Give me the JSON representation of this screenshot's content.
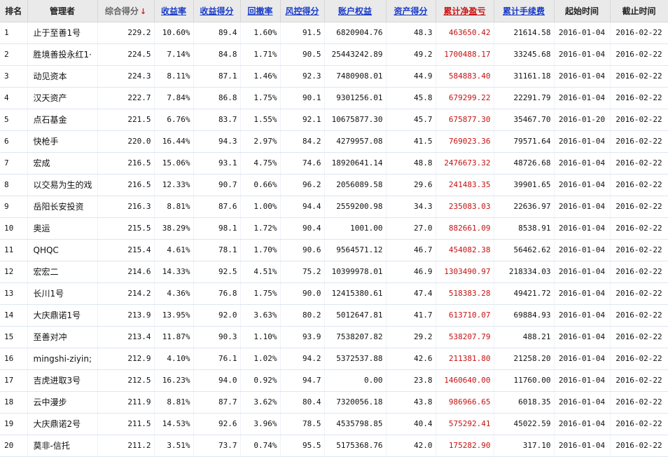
{
  "columns": [
    {
      "key": "rank",
      "label": "排名"
    },
    {
      "key": "manager",
      "label": "管理者"
    },
    {
      "key": "total_score",
      "label": "综合得分",
      "sort_icon": "down-arrow-icon"
    },
    {
      "key": "return_rate",
      "label": "收益率"
    },
    {
      "key": "return_score",
      "label": "收益得分"
    },
    {
      "key": "drawdown",
      "label": "回撤率"
    },
    {
      "key": "risk_score",
      "label": "风控得分"
    },
    {
      "key": "equity",
      "label": "账户权益"
    },
    {
      "key": "asset_score",
      "label": "资产得分"
    },
    {
      "key": "net_pnl",
      "label": "累计净盈亏"
    },
    {
      "key": "fees",
      "label": "累计手续费"
    },
    {
      "key": "start",
      "label": "起始时间"
    },
    {
      "key": "end",
      "label": "截止时间"
    }
  ],
  "rows": [
    {
      "rank": "1",
      "manager": "止于至善1号",
      "total_score": "229.2",
      "return_rate": "10.60%",
      "return_score": "89.4",
      "drawdown": "1.60%",
      "risk_score": "91.5",
      "equity": "6820904.76",
      "asset_score": "48.3",
      "net_pnl": "463650.42",
      "fees": "21614.58",
      "start": "2016-01-04",
      "end": "2016-02-22"
    },
    {
      "rank": "2",
      "manager": "胜境善投永红1·",
      "total_score": "224.5",
      "return_rate": "7.14%",
      "return_score": "84.8",
      "drawdown": "1.71%",
      "risk_score": "90.5",
      "equity": "25443242.89",
      "asset_score": "49.2",
      "net_pnl": "1700488.17",
      "fees": "33245.68",
      "start": "2016-01-04",
      "end": "2016-02-22"
    },
    {
      "rank": "3",
      "manager": "动见资本",
      "total_score": "224.3",
      "return_rate": "8.11%",
      "return_score": "87.1",
      "drawdown": "1.46%",
      "risk_score": "92.3",
      "equity": "7480908.01",
      "asset_score": "44.9",
      "net_pnl": "584883.40",
      "fees": "31161.18",
      "start": "2016-01-04",
      "end": "2016-02-22"
    },
    {
      "rank": "4",
      "manager": "汉天资产",
      "total_score": "222.7",
      "return_rate": "7.84%",
      "return_score": "86.8",
      "drawdown": "1.75%",
      "risk_score": "90.1",
      "equity": "9301256.01",
      "asset_score": "45.8",
      "net_pnl": "679299.22",
      "fees": "22291.79",
      "start": "2016-01-04",
      "end": "2016-02-22"
    },
    {
      "rank": "5",
      "manager": "点石基金",
      "total_score": "221.5",
      "return_rate": "6.76%",
      "return_score": "83.7",
      "drawdown": "1.55%",
      "risk_score": "92.1",
      "equity": "10675877.30",
      "asset_score": "45.7",
      "net_pnl": "675877.30",
      "fees": "35467.70",
      "start": "2016-01-20",
      "end": "2016-02-22"
    },
    {
      "rank": "6",
      "manager": "快枪手",
      "total_score": "220.0",
      "return_rate": "16.44%",
      "return_score": "94.3",
      "drawdown": "2.97%",
      "risk_score": "84.2",
      "equity": "4279957.08",
      "asset_score": "41.5",
      "net_pnl": "769023.36",
      "fees": "79571.64",
      "start": "2016-01-04",
      "end": "2016-02-22"
    },
    {
      "rank": "7",
      "manager": "宏成",
      "total_score": "216.5",
      "return_rate": "15.06%",
      "return_score": "93.1",
      "drawdown": "4.75%",
      "risk_score": "74.6",
      "equity": "18920641.14",
      "asset_score": "48.8",
      "net_pnl": "2476673.32",
      "fees": "48726.68",
      "start": "2016-01-04",
      "end": "2016-02-22"
    },
    {
      "rank": "8",
      "manager": "以交易为生的戏",
      "total_score": "216.5",
      "return_rate": "12.33%",
      "return_score": "90.7",
      "drawdown": "0.66%",
      "risk_score": "96.2",
      "equity": "2056089.58",
      "asset_score": "29.6",
      "net_pnl": "241483.35",
      "fees": "39901.65",
      "start": "2016-01-04",
      "end": "2016-02-22"
    },
    {
      "rank": "9",
      "manager": "岳阳长安投资",
      "total_score": "216.3",
      "return_rate": "8.81%",
      "return_score": "87.6",
      "drawdown": "1.00%",
      "risk_score": "94.4",
      "equity": "2559200.98",
      "asset_score": "34.3",
      "net_pnl": "235083.03",
      "fees": "22636.97",
      "start": "2016-01-04",
      "end": "2016-02-22"
    },
    {
      "rank": "10",
      "manager": "奥运",
      "total_score": "215.5",
      "return_rate": "38.29%",
      "return_score": "98.1",
      "drawdown": "1.72%",
      "risk_score": "90.4",
      "equity": "1001.00",
      "asset_score": "27.0",
      "net_pnl": "882661.09",
      "fees": "8538.91",
      "start": "2016-01-04",
      "end": "2016-02-22"
    },
    {
      "rank": "11",
      "manager": "QHQC",
      "total_score": "215.4",
      "return_rate": "4.61%",
      "return_score": "78.1",
      "drawdown": "1.70%",
      "risk_score": "90.6",
      "equity": "9564571.12",
      "asset_score": "46.7",
      "net_pnl": "454082.38",
      "fees": "56462.62",
      "start": "2016-01-04",
      "end": "2016-02-22"
    },
    {
      "rank": "12",
      "manager": "宏宏二",
      "total_score": "214.6",
      "return_rate": "14.33%",
      "return_score": "92.5",
      "drawdown": "4.51%",
      "risk_score": "75.2",
      "equity": "10399978.01",
      "asset_score": "46.9",
      "net_pnl": "1303490.97",
      "fees": "218334.03",
      "start": "2016-01-04",
      "end": "2016-02-22"
    },
    {
      "rank": "13",
      "manager": "长川1号",
      "total_score": "214.2",
      "return_rate": "4.36%",
      "return_score": "76.8",
      "drawdown": "1.75%",
      "risk_score": "90.0",
      "equity": "12415380.61",
      "asset_score": "47.4",
      "net_pnl": "518383.28",
      "fees": "49421.72",
      "start": "2016-01-04",
      "end": "2016-02-22"
    },
    {
      "rank": "14",
      "manager": "大庆鼎诺1号",
      "total_score": "213.9",
      "return_rate": "13.95%",
      "return_score": "92.0",
      "drawdown": "3.63%",
      "risk_score": "80.2",
      "equity": "5012647.81",
      "asset_score": "41.7",
      "net_pnl": "613710.07",
      "fees": "69884.93",
      "start": "2016-01-04",
      "end": "2016-02-22"
    },
    {
      "rank": "15",
      "manager": "至善对冲",
      "total_score": "213.4",
      "return_rate": "11.87%",
      "return_score": "90.3",
      "drawdown": "1.10%",
      "risk_score": "93.9",
      "equity": "7538207.82",
      "asset_score": "29.2",
      "net_pnl": "538207.79",
      "fees": "488.21",
      "start": "2016-01-04",
      "end": "2016-02-22"
    },
    {
      "rank": "16",
      "manager": "mingshi-ziyin;",
      "total_score": "212.9",
      "return_rate": "4.10%",
      "return_score": "76.1",
      "drawdown": "1.02%",
      "risk_score": "94.2",
      "equity": "5372537.88",
      "asset_score": "42.6",
      "net_pnl": "211381.80",
      "fees": "21258.20",
      "start": "2016-01-04",
      "end": "2016-02-22"
    },
    {
      "rank": "17",
      "manager": "吉虎进取3号",
      "total_score": "212.5",
      "return_rate": "16.23%",
      "return_score": "94.0",
      "drawdown": "0.92%",
      "risk_score": "94.7",
      "equity": "0.00",
      "asset_score": "23.8",
      "net_pnl": "1460640.00",
      "fees": "11760.00",
      "start": "2016-01-04",
      "end": "2016-02-22"
    },
    {
      "rank": "18",
      "manager": "云中漫步",
      "total_score": "211.9",
      "return_rate": "8.81%",
      "return_score": "87.7",
      "drawdown": "3.62%",
      "risk_score": "80.4",
      "equity": "7320056.18",
      "asset_score": "43.8",
      "net_pnl": "986966.65",
      "fees": "6018.35",
      "start": "2016-01-04",
      "end": "2016-02-22"
    },
    {
      "rank": "19",
      "manager": "大庆鼎诺2号",
      "total_score": "211.5",
      "return_rate": "14.53%",
      "return_score": "92.6",
      "drawdown": "3.96%",
      "risk_score": "78.5",
      "equity": "4535798.85",
      "asset_score": "40.4",
      "net_pnl": "575292.41",
      "fees": "45022.59",
      "start": "2016-01-04",
      "end": "2016-02-22"
    },
    {
      "rank": "20",
      "manager": "莫非-信托",
      "total_score": "211.2",
      "return_rate": "3.51%",
      "return_score": "73.7",
      "drawdown": "0.74%",
      "risk_score": "95.5",
      "equity": "5175368.76",
      "asset_score": "42.0",
      "net_pnl": "175282.90",
      "fees": "317.10",
      "start": "2016-01-04",
      "end": "2016-02-22"
    }
  ],
  "colors": {
    "link": "#1a3cc8",
    "profit": "#c41212",
    "sort_arrow": "#d81b1b",
    "header_bg": "#eaeaea"
  }
}
